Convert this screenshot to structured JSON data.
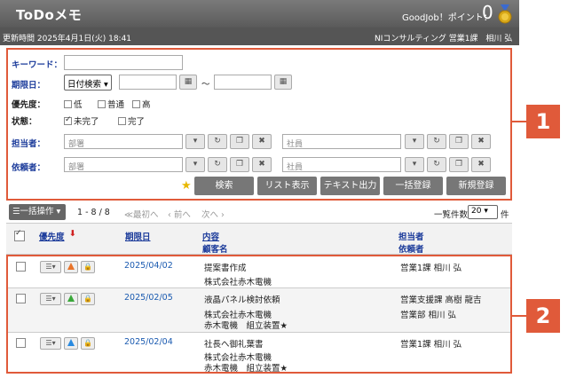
{
  "header": {
    "title": "ToDoメモ",
    "goodjob": "GoodJob！ポイント：",
    "points": "0"
  },
  "subheader": {
    "updated": "更新時間 2025年4月1日(火) 18:41",
    "user": "NIコンサルティング 営業1課　相川 弘"
  },
  "search": {
    "keyword_label": "キーワード：",
    "due_label": "期限日：",
    "due_select": "日付検索",
    "tilde": "～",
    "priority_label": "優先度：",
    "priorities": [
      "低",
      "普通",
      "高"
    ],
    "status_label": "状態：",
    "statuses": [
      "未完了",
      "完了"
    ],
    "assignee_label": "担当者：",
    "requester_label": "依頼者：",
    "dept_placeholder": "部署",
    "emp_placeholder": "社員",
    "buttons": [
      "検索",
      "リスト表示",
      "テキスト出力",
      "一括登録",
      "新規登録"
    ]
  },
  "callouts": [
    "1",
    "2"
  ],
  "toolbar": {
    "bulk": "☰一括操作 ▾",
    "range": "1 - 8 / 8",
    "first": "≪最初へ",
    "prev": "‹ 前へ",
    "next": "次へ ›",
    "count_label": "一覧件数",
    "count": "20",
    "count_unit": "件"
  },
  "columns": {
    "priority": "優先度",
    "due": "期限日",
    "content": "内容",
    "customer": "顧客名",
    "assignee": "担当者",
    "requester": "依頼者"
  },
  "tasks": [
    {
      "due": "2025/04/02",
      "content": "提案書作成",
      "customer": "株式会社赤木電機",
      "customer2": "",
      "assignee": "営業1課 相川 弘",
      "requester": "",
      "priority_color": "#e8742a"
    },
    {
      "due": "2025/02/05",
      "content": "液晶パネル検討依頼",
      "customer": "株式会社赤木電機",
      "customer2": "赤木電機　組立装置★",
      "assignee": "営業支援課 高樹 龍吉",
      "requester": "営業部 相川 弘",
      "priority_color": "#3aa83a"
    },
    {
      "due": "2025/02/04",
      "content": "社長へ御礼葉書",
      "customer": "株式会社赤木電機",
      "customer2": "赤木電機　組立装置★",
      "assignee": "営業1課 相川 弘",
      "requester": "",
      "priority_color": "#2a8ae0"
    }
  ]
}
